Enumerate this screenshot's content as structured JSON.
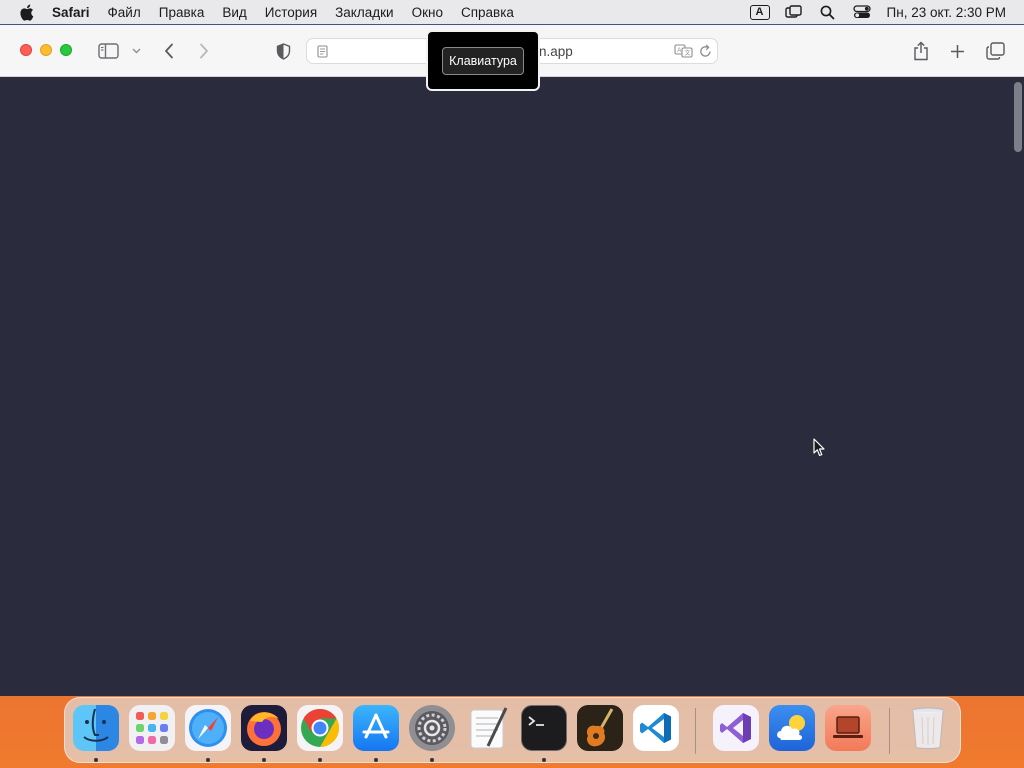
{
  "menubar": {
    "app_name": "Safari",
    "items": [
      "Файл",
      "Правка",
      "Вид",
      "История",
      "Закладки",
      "Окно",
      "Справка"
    ],
    "input_source": "A",
    "clock": "Пн, 23 окт.  2:30 PM",
    "status_icons": [
      "input-source-icon",
      "screen-mirroring-icon",
      "spotlight-search-icon",
      "control-center-icon"
    ]
  },
  "toolbar": {
    "url": "n.app",
    "tooltip": "Клавиатура"
  },
  "dock": {
    "apps": [
      {
        "name": "Finder",
        "icon": "finder-icon",
        "running": true
      },
      {
        "name": "Launchpad",
        "icon": "launchpad-icon",
        "running": false
      },
      {
        "name": "Safari",
        "icon": "safari-icon",
        "running": true
      },
      {
        "name": "Firefox",
        "icon": "firefox-icon",
        "running": true
      },
      {
        "name": "Google Chrome",
        "icon": "chrome-icon",
        "running": true
      },
      {
        "name": "App Store",
        "icon": "app-store-icon",
        "running": true
      },
      {
        "name": "System Settings",
        "icon": "system-settings-icon",
        "running": true
      },
      {
        "name": "TextEdit",
        "icon": "textedit-icon",
        "running": false
      },
      {
        "name": "Terminal",
        "icon": "terminal-icon",
        "running": true
      },
      {
        "name": "GarageBand",
        "icon": "garageband-icon",
        "running": false
      },
      {
        "name": "Visual Studio Code",
        "icon": "vscode-icon",
        "running": false
      },
      {
        "name": "Visual Studio",
        "icon": "visual-studio-icon",
        "running": false
      },
      {
        "name": "Weather",
        "icon": "weather-icon",
        "running": false
      },
      {
        "name": "Screen Sharing",
        "icon": "screen-sharing-icon",
        "running": false
      },
      {
        "name": "Trash",
        "icon": "trash-icon",
        "running": false
      }
    ]
  },
  "colors": {
    "page_background": "#2a2b3c",
    "toolbar_background": "#f6f6f6",
    "menubar_background": "#e9e9ec"
  }
}
